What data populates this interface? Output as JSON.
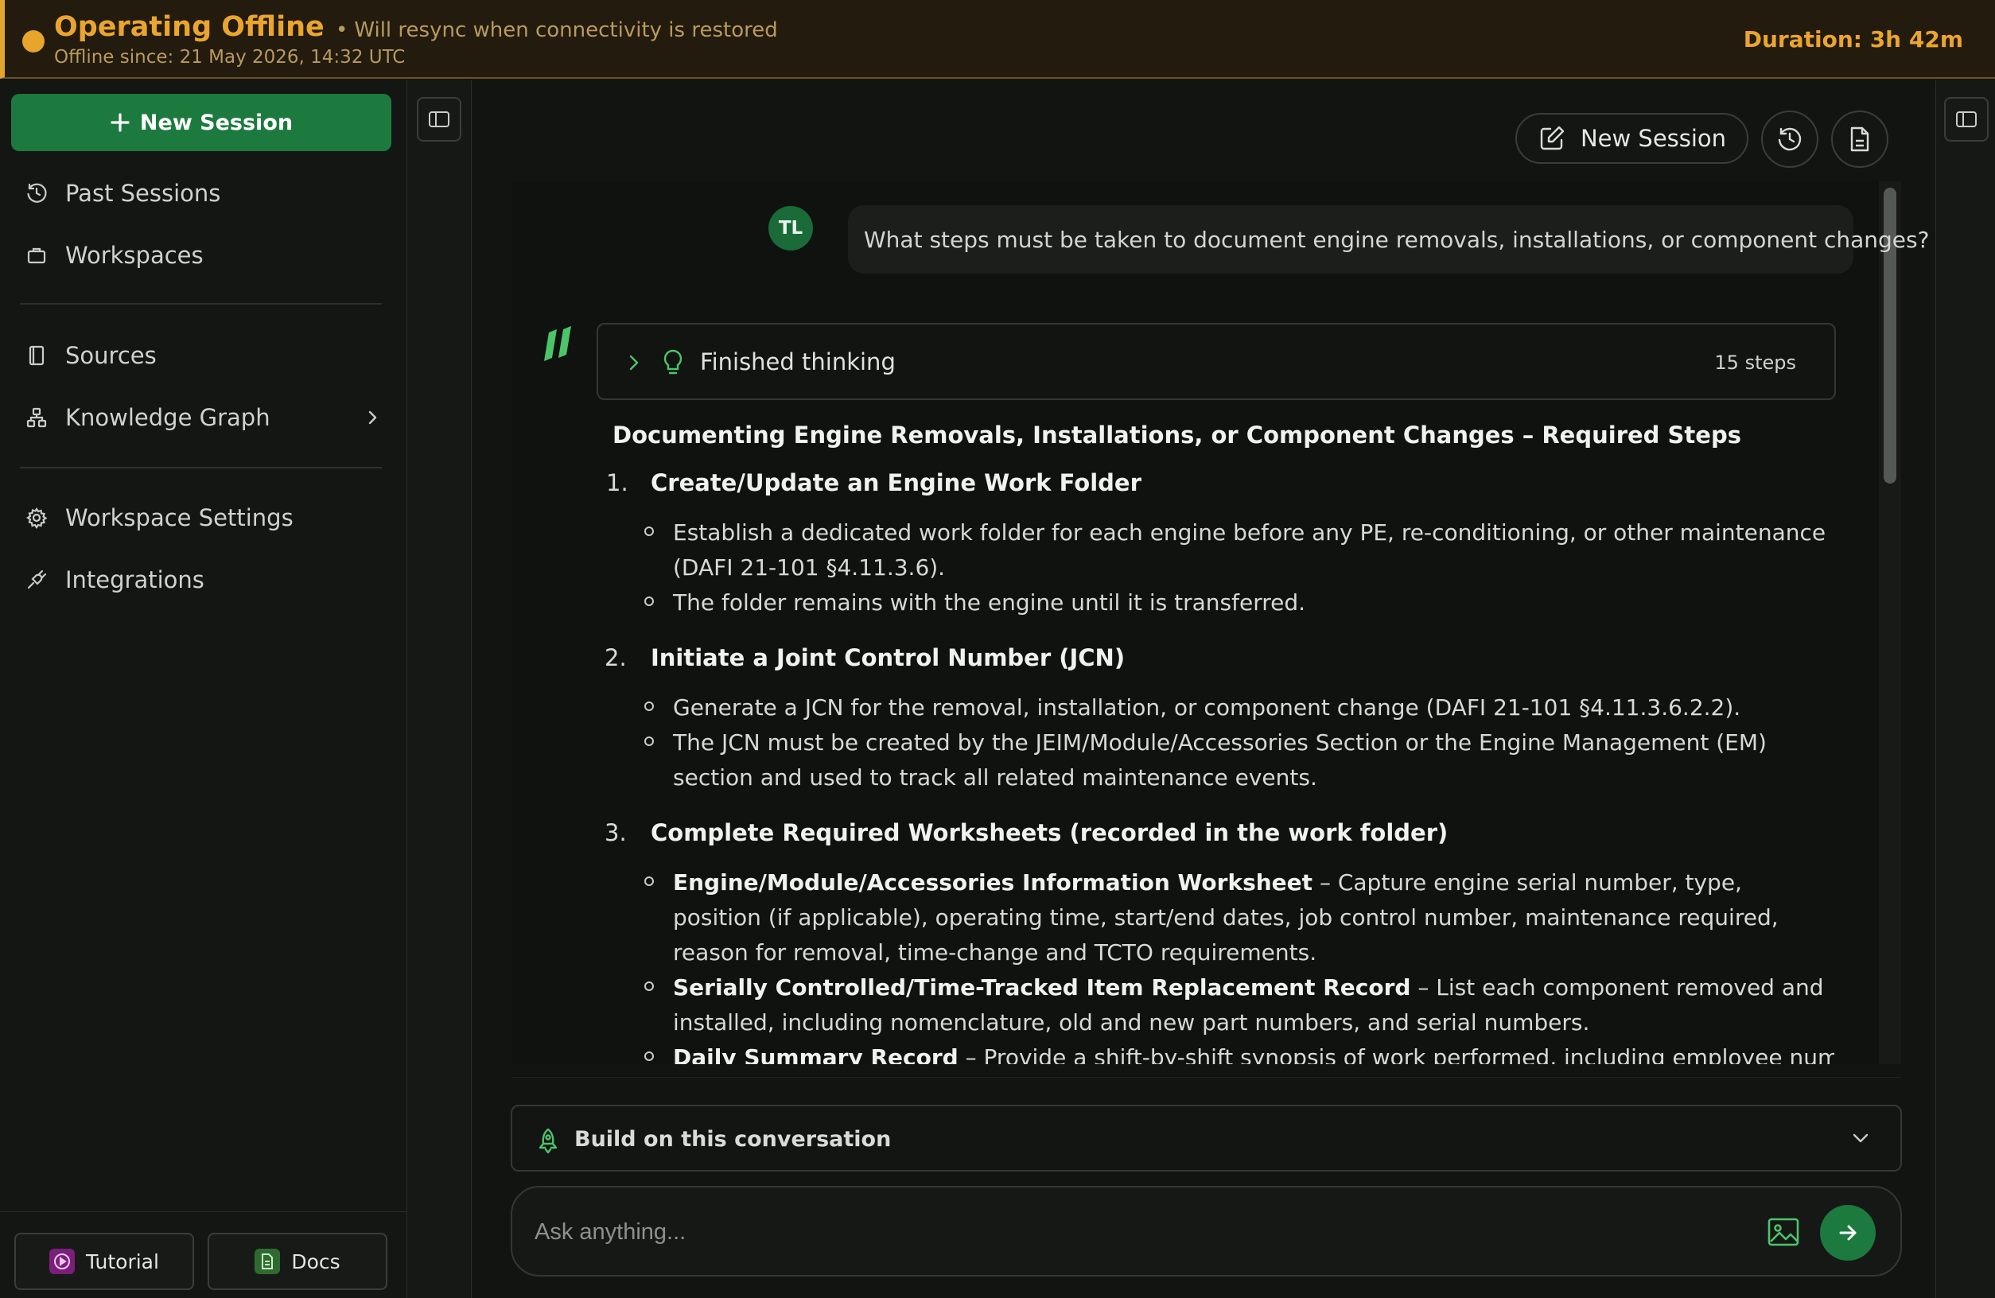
{
  "banner": {
    "title": "Operating Offline",
    "separator": "•",
    "note": "Will resync when connectivity is restored",
    "since": "Offline since: 21 May 2026, 14:32 UTC",
    "duration": "Duration: 3h 42m",
    "accent_color": "#e8a52c"
  },
  "sidebar": {
    "new_session_label": "New Session",
    "items": [
      {
        "label": "Past Sessions",
        "icon": "history-icon"
      },
      {
        "label": "Workspaces",
        "icon": "briefcase-icon"
      },
      {
        "label": "Sources",
        "icon": "book-icon"
      },
      {
        "label": "Knowledge Graph",
        "icon": "graph-icon"
      },
      {
        "label": "Workspace Settings",
        "icon": "gear-icon"
      },
      {
        "label": "Integrations",
        "icon": "plug-icon"
      }
    ],
    "footer": {
      "tutorial_label": "Tutorial",
      "docs_label": "Docs"
    }
  },
  "toolbar": {
    "new_session_label": "New Session"
  },
  "conversation": {
    "user_initials": "TL",
    "user_message": "What steps must be taken to document engine removals, installations, or component changes?",
    "thinking": {
      "label": "Finished thinking",
      "steps": "15 steps"
    },
    "answer": {
      "title": "Documenting Engine Removals, Installations, or Component Changes – Required Steps",
      "sections": [
        {
          "number": "1.",
          "title": "Create/Update an Engine Work Folder",
          "bullets": [
            {
              "bold": "",
              "text": "Establish a dedicated work folder for each engine before any PE, re-conditioning, or other maintenance (DAFI 21-101 §4.11.3.6)."
            },
            {
              "bold": "",
              "text": "The folder remains with the engine until it is transferred."
            }
          ]
        },
        {
          "number": "2.",
          "title": "Initiate a Joint Control Number (JCN)",
          "bullets": [
            {
              "bold": "",
              "text": "Generate a JCN for the removal, installation, or component change (DAFI 21-101 §4.11.3.6.2.2)."
            },
            {
              "bold": "",
              "text": "The JCN must be created by the JEIM/Module/Accessories Section or the Engine Management (EM) section and used to track all related maintenance events."
            }
          ]
        },
        {
          "number": "3.",
          "title": "Complete Required Worksheets (recorded in the work folder)",
          "bullets": [
            {
              "bold": "Engine/Module/Accessories Information Worksheet",
              "text": " – Capture engine serial number, type, position (if applicable), operating time, start/end dates, job control number, maintenance required, reason for removal, time-change and TCTO requirements."
            },
            {
              "bold": "Serially Controlled/Time-Tracked Item Replacement Record",
              "text": " – List each component removed and installed, including nomenclature, old and new part numbers, and serial numbers."
            },
            {
              "bold": "Daily Summary Record",
              "text": " – Provide a shift-by-shift synopsis of work performed, including employee numbers and"
            }
          ]
        }
      ]
    }
  },
  "composer": {
    "build_label": "Build on this conversation",
    "placeholder": "Ask anything..."
  },
  "colors": {
    "brand_green": "#1d7a3e",
    "logo_green": "#4cc46a",
    "background": "#121412"
  }
}
